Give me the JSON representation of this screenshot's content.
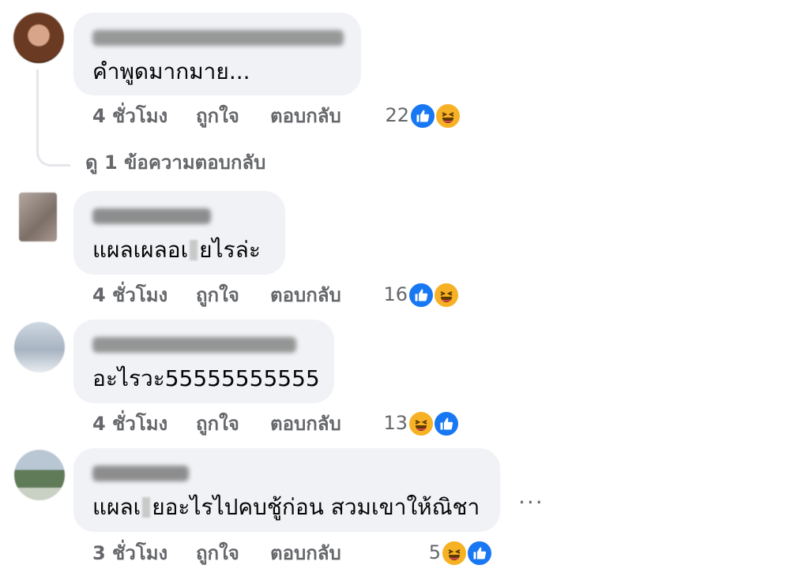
{
  "comments": [
    {
      "text": "คำพูดมากมาย...",
      "time": "4 ชั่วโมง",
      "like_label": "ถูกใจ",
      "reply_label": "ตอบกลับ",
      "reaction_count": "22",
      "reactions": [
        "like-icon",
        "haha-icon"
      ]
    },
    {
      "text_before": "แผลเผลอเ",
      "text_after": "ยไรล่ะ",
      "time": "4 ชั่วโมง",
      "like_label": "ถูกใจ",
      "reply_label": "ตอบกลับ",
      "reaction_count": "16",
      "reactions": [
        "like-icon",
        "haha-icon"
      ]
    },
    {
      "text": "อะไรวะ55555555555",
      "time": "4 ชั่วโมง",
      "like_label": "ถูกใจ",
      "reply_label": "ตอบกลับ",
      "reaction_count": "13",
      "reactions": [
        "haha-icon",
        "like-icon"
      ]
    },
    {
      "text_before": "แผลเ",
      "text_after": "ยอะไรไปคบชู้ก่อน สวมเขาให้ณิชา",
      "time": "3 ชั่วโมง",
      "like_label": "ถูกใจ",
      "reply_label": "ตอบกลับ",
      "reaction_count": "5",
      "reactions": [
        "haha-icon",
        "like-icon"
      ]
    }
  ],
  "view_replies": "ดู 1 ข้อความตอบกลับ",
  "more_options": "...",
  "colors": {
    "like": "#1877f2",
    "haha": "#f7b125",
    "bubble": "#f0f2f5",
    "meta": "#65676b"
  }
}
